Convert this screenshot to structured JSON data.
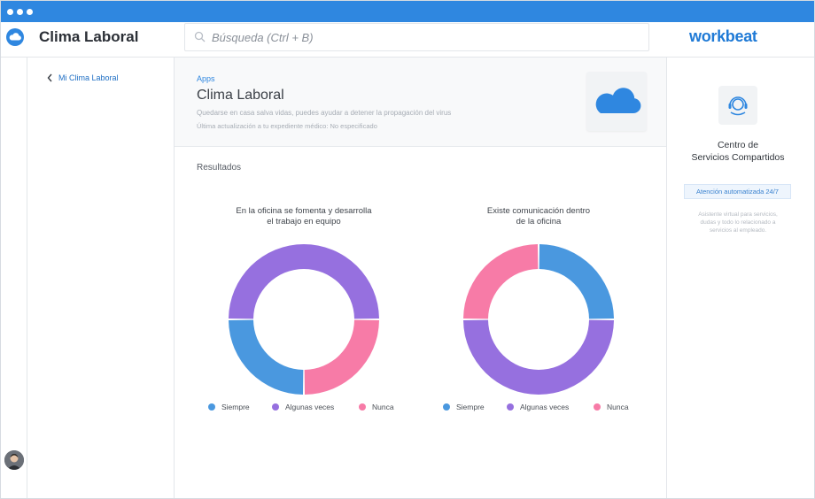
{
  "window": {
    "title_bar_color": "#2f87e0"
  },
  "topbar": {
    "app_title": "Clima Laboral",
    "search_placeholder": "Búsqueda (Ctrl + B)",
    "brand": "workbeat"
  },
  "nav": {
    "back_label": "Mi Clima Laboral"
  },
  "header": {
    "breadcrumb": "Apps",
    "title": "Clima Laboral",
    "subtitle": "Quedarse en casa salva vidas, puedes ayudar a detener la propagación del virus",
    "updated": "Última actualización a tu expediente médico: No especificado",
    "hero_icon": "cloud-icon"
  },
  "results_label": "Resultados",
  "colors": {
    "siempre": "#4a98df",
    "algunas_veces": "#9670df",
    "nunca": "#f77ba7"
  },
  "chart_data": [
    {
      "type": "pie",
      "title_line1": "En la oficina se fomenta y desarrolla",
      "title_line2": "el trabajo en equipo",
      "categories": [
        "Siempre",
        "Algunas veces",
        "Nunca"
      ],
      "values": [
        25,
        50,
        25
      ]
    },
    {
      "type": "pie",
      "title_line1": "Existe comunicación dentro",
      "title_line2": "de la oficina",
      "categories": [
        "Siempre",
        "Algunas veces",
        "Nunca"
      ],
      "values": [
        25,
        50,
        25
      ]
    }
  ],
  "sidebar_right": {
    "title_line1": "Centro de",
    "title_line2": "Servicios Compartidos",
    "badge": "Atención automatizada 24/7",
    "desc_line1": "Asistente virtual para servicios,",
    "desc_line2": "dudas y todo lo relacionado a",
    "desc_line3": "servicios al empleado.",
    "icon": "headset-icon"
  }
}
